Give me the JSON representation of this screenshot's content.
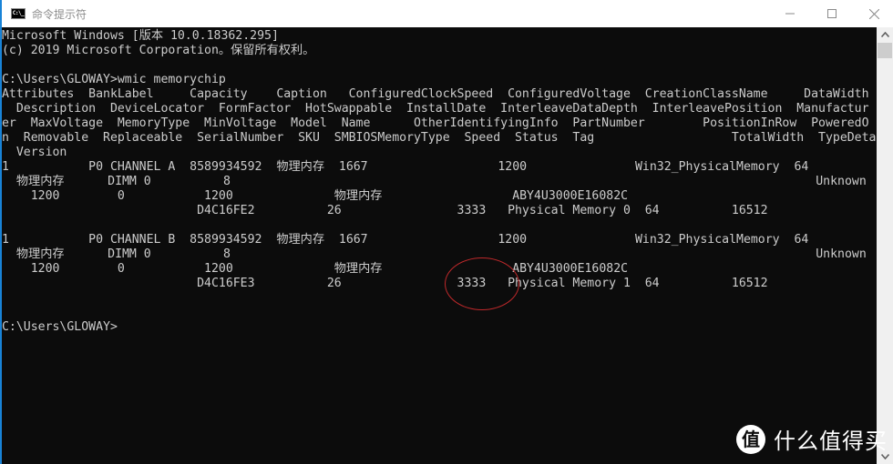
{
  "window": {
    "title": "命令提示符",
    "icon_label": "C:\\_",
    "icon": "cmd-icon",
    "controls": {
      "minimize": "minimize-icon",
      "maximize": "maximize-icon",
      "close": "close-icon"
    }
  },
  "console": {
    "lines": [
      "Microsoft Windows [版本 10.0.18362.295]",
      "(c) 2019 Microsoft Corporation。保留所有权利。",
      "",
      "C:\\Users\\GLOWAY>wmic memorychip",
      "Attributes  BankLabel     Capacity    Caption   ConfiguredClockSpeed  ConfiguredVoltage  CreationClassName     DataWidth",
      "  Description  DeviceLocator  FormFactor  HotSwappable  InstallDate  InterleaveDataDepth  InterleavePosition  Manufactur",
      "er  MaxVoltage  MemoryType  MinVoltage  Model  Name      OtherIdentifyingInfo  PartNumber        PositionInRow  PoweredO",
      "n  Removable  Replaceable  SerialNumber  SKU  SMBIOSMemoryType  Speed  Status  Tag                   TotalWidth  TypeDetail",
      "  Version",
      "1           P0 CHANNEL A  8589934592  物理内存  1667                  1200               Win32_PhysicalMemory  64",
      "  物理内存      DIMM 0          8                                                                                 Unknown",
      "    1200        0           1200              物理内存                  ABY4U3000E16082C",
      "                           D4C16FE2          26                3333   Physical Memory 0  64          16512",
      "",
      "1           P0 CHANNEL B  8589934592  物理内存  1667                  1200               Win32_PhysicalMemory  64",
      "  物理内存      DIMM 0          8                                                                                 Unknown",
      "    1200        0           1200              物理内存                  ABY4U3000E16082C",
      "                           D4C16FE3          26                3333   Physical Memory 1  64          16512",
      "",
      "",
      "C:\\Users\\GLOWAY>"
    ]
  },
  "annotation": {
    "highlighted_value": "3333",
    "color": "#c0292b"
  },
  "watermark": {
    "logo_char": "值",
    "text": "什么值得买"
  },
  "colors": {
    "console_bg": "#0c0c0c",
    "console_fg": "#cccccc",
    "accent": "#1883d7"
  }
}
